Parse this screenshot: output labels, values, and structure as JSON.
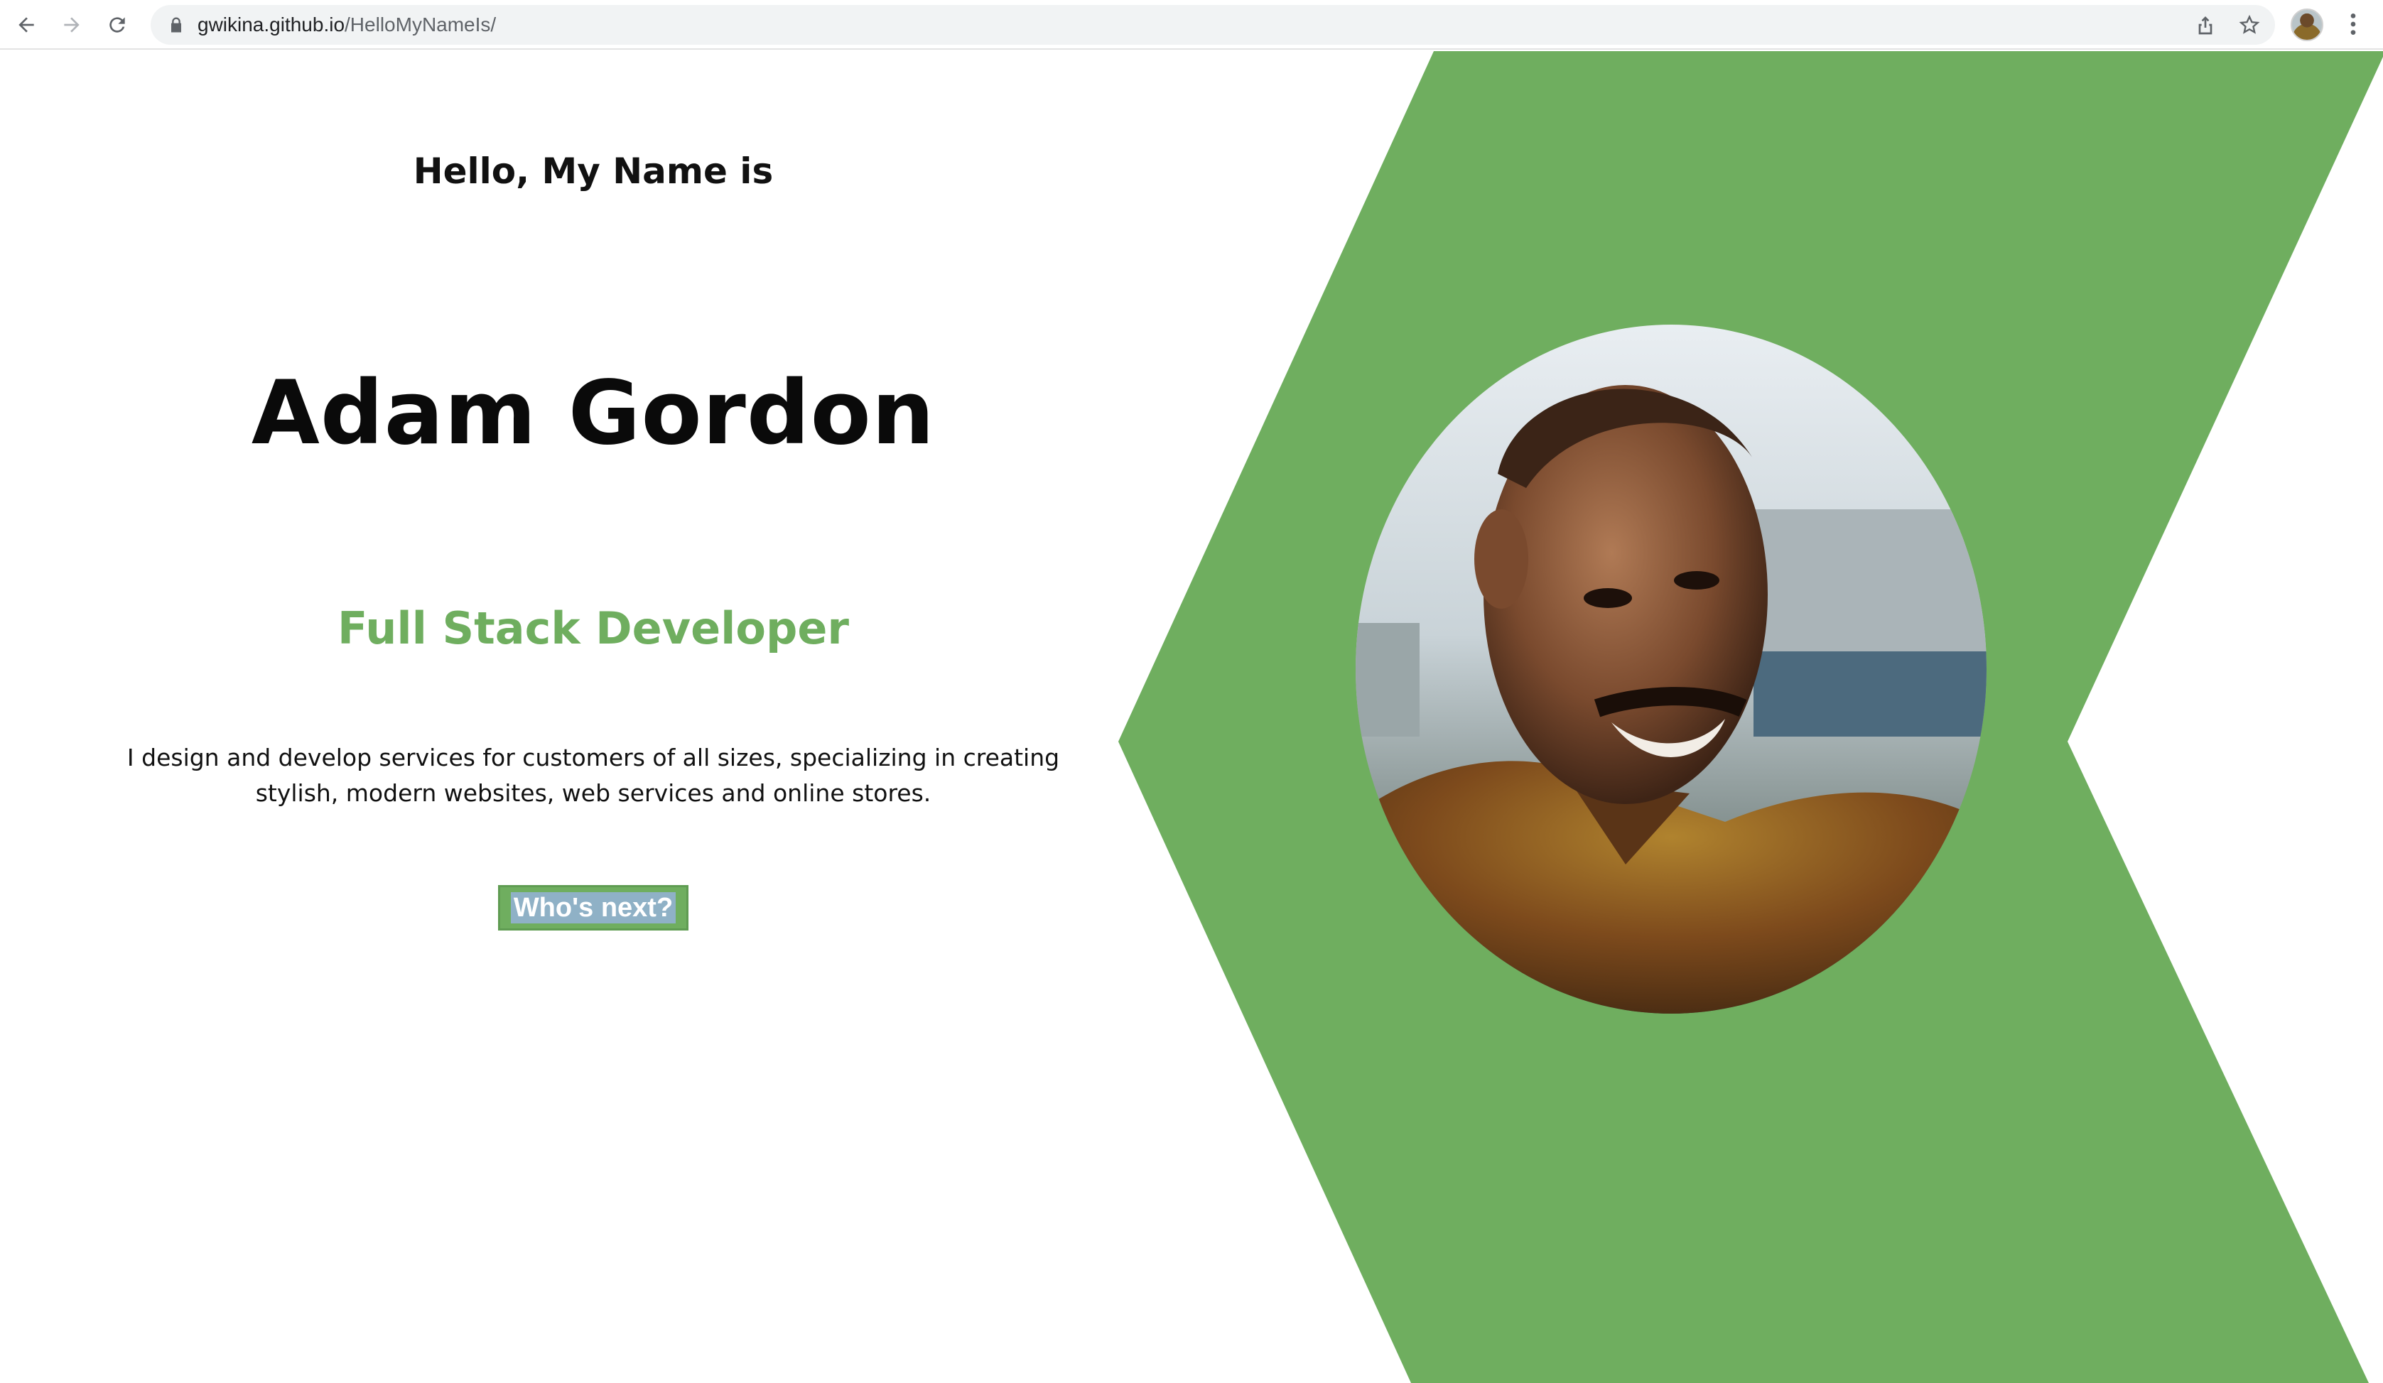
{
  "browser": {
    "url_host": "gwikina.github.io",
    "url_path": "/HelloMyNameIs/",
    "icons": [
      "back-arrow-icon",
      "forward-arrow-icon",
      "reload-icon",
      "lock-icon",
      "share-icon",
      "bookmark-star-icon",
      "profile-avatar",
      "kebab-menu-icon"
    ]
  },
  "hero": {
    "greeting": "Hello, My Name is",
    "name": "Adam Gordon",
    "role": "Full Stack Developer",
    "bio": "I design and develop services for customers of all sizes, specializing in creating stylish, modern websites, web services and online stores.",
    "cta_label": "Who's next?"
  },
  "colors": {
    "accent_green": "#6fae5f",
    "text": "#111111",
    "background": "#ffffff"
  }
}
